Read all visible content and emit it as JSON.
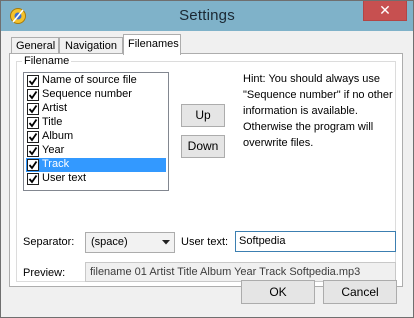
{
  "window": {
    "title": "Settings",
    "close_glyph": "✕"
  },
  "tabs": [
    {
      "label": "General"
    },
    {
      "label": "Navigation"
    },
    {
      "label": "Filenames"
    }
  ],
  "filename_group": {
    "legend": "Filename",
    "items": [
      {
        "label": "Name of source file",
        "checked": true
      },
      {
        "label": "Sequence number",
        "checked": true
      },
      {
        "label": "Artist",
        "checked": true
      },
      {
        "label": "Title",
        "checked": true
      },
      {
        "label": "Album",
        "checked": true
      },
      {
        "label": "Year",
        "checked": true
      },
      {
        "label": "Track",
        "checked": true,
        "selected": true
      },
      {
        "label": "User text",
        "checked": true
      }
    ],
    "up_label": "Up",
    "down_label": "Down",
    "hint": "Hint: You should always use \"Sequence number\" if no other information is available. Otherwise the program will overwrite files.",
    "separator_label": "Separator:",
    "separator_value": "(space)",
    "user_text_label": "User text:",
    "user_text_value": "Softpedia",
    "preview_label": "Preview:",
    "preview_value": "filename 01 Artist Title Album Year Track Softpedia.mp3"
  },
  "footer": {
    "ok_label": "OK",
    "cancel_label": "Cancel"
  },
  "colors": {
    "titlebar": "#7fb2c9",
    "selection": "#3399ff",
    "close": "#c75050"
  }
}
